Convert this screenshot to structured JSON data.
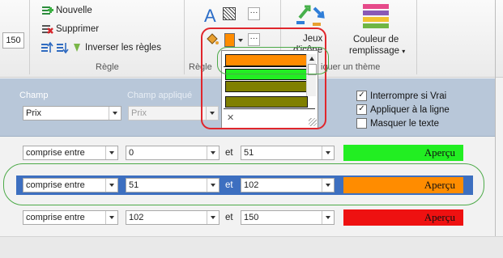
{
  "ribbon": {
    "number_box": "150",
    "add_label": "Nouvelle",
    "delete_label": "Supprimer",
    "reverse_label": "Inverser les règles",
    "rule_group_label": "Règle",
    "rule_group_label_partial": "Règle",
    "theme_btn_label_1": "Jeux",
    "theme_btn_label_2": "d'icône",
    "fill_color_label_1": "Couleur de",
    "fill_color_label_2": "remplissage",
    "apply_theme_label_partial": "iquer un thème",
    "dropdown_arrow": "▾"
  },
  "panel": {
    "field_label": "Champ",
    "field_value": "Prix",
    "applied_field_label": "Champ appliqué",
    "applied_field_value": "Prix",
    "checkbox_stop_label": "Interrompre si Vrai",
    "checkbox_stop_checked": "✓",
    "checkbox_apply_row_label": "Appliquer à la ligne",
    "checkbox_apply_row_checked": "✓",
    "checkbox_hide_text_label": "Masquer le texte",
    "checkbox_hide_text_checked": ""
  },
  "rows": [
    {
      "operator": "comprise entre",
      "value1": "0",
      "connector": "et",
      "value2": "51",
      "preview_text": "Aperçu",
      "color": "#22ee22"
    },
    {
      "operator": "comprise entre",
      "value1": "51",
      "connector": "et",
      "value2": "102",
      "preview_text": "Aperçu",
      "color": "#ff8c00"
    },
    {
      "operator": "comprise entre",
      "value1": "102",
      "connector": "et",
      "value2": "150",
      "preview_text": "Aperçu",
      "color": "#ee1111"
    }
  ],
  "color_popup": {
    "swatches": [
      "#ff8c00",
      "#22ee22",
      "#808000",
      "#808000"
    ],
    "close_glyph": "✕"
  },
  "colors": {
    "selected_row": "#3d6fc0",
    "annotation_red": "#e0262c",
    "annotation_green": "#4caa48"
  }
}
